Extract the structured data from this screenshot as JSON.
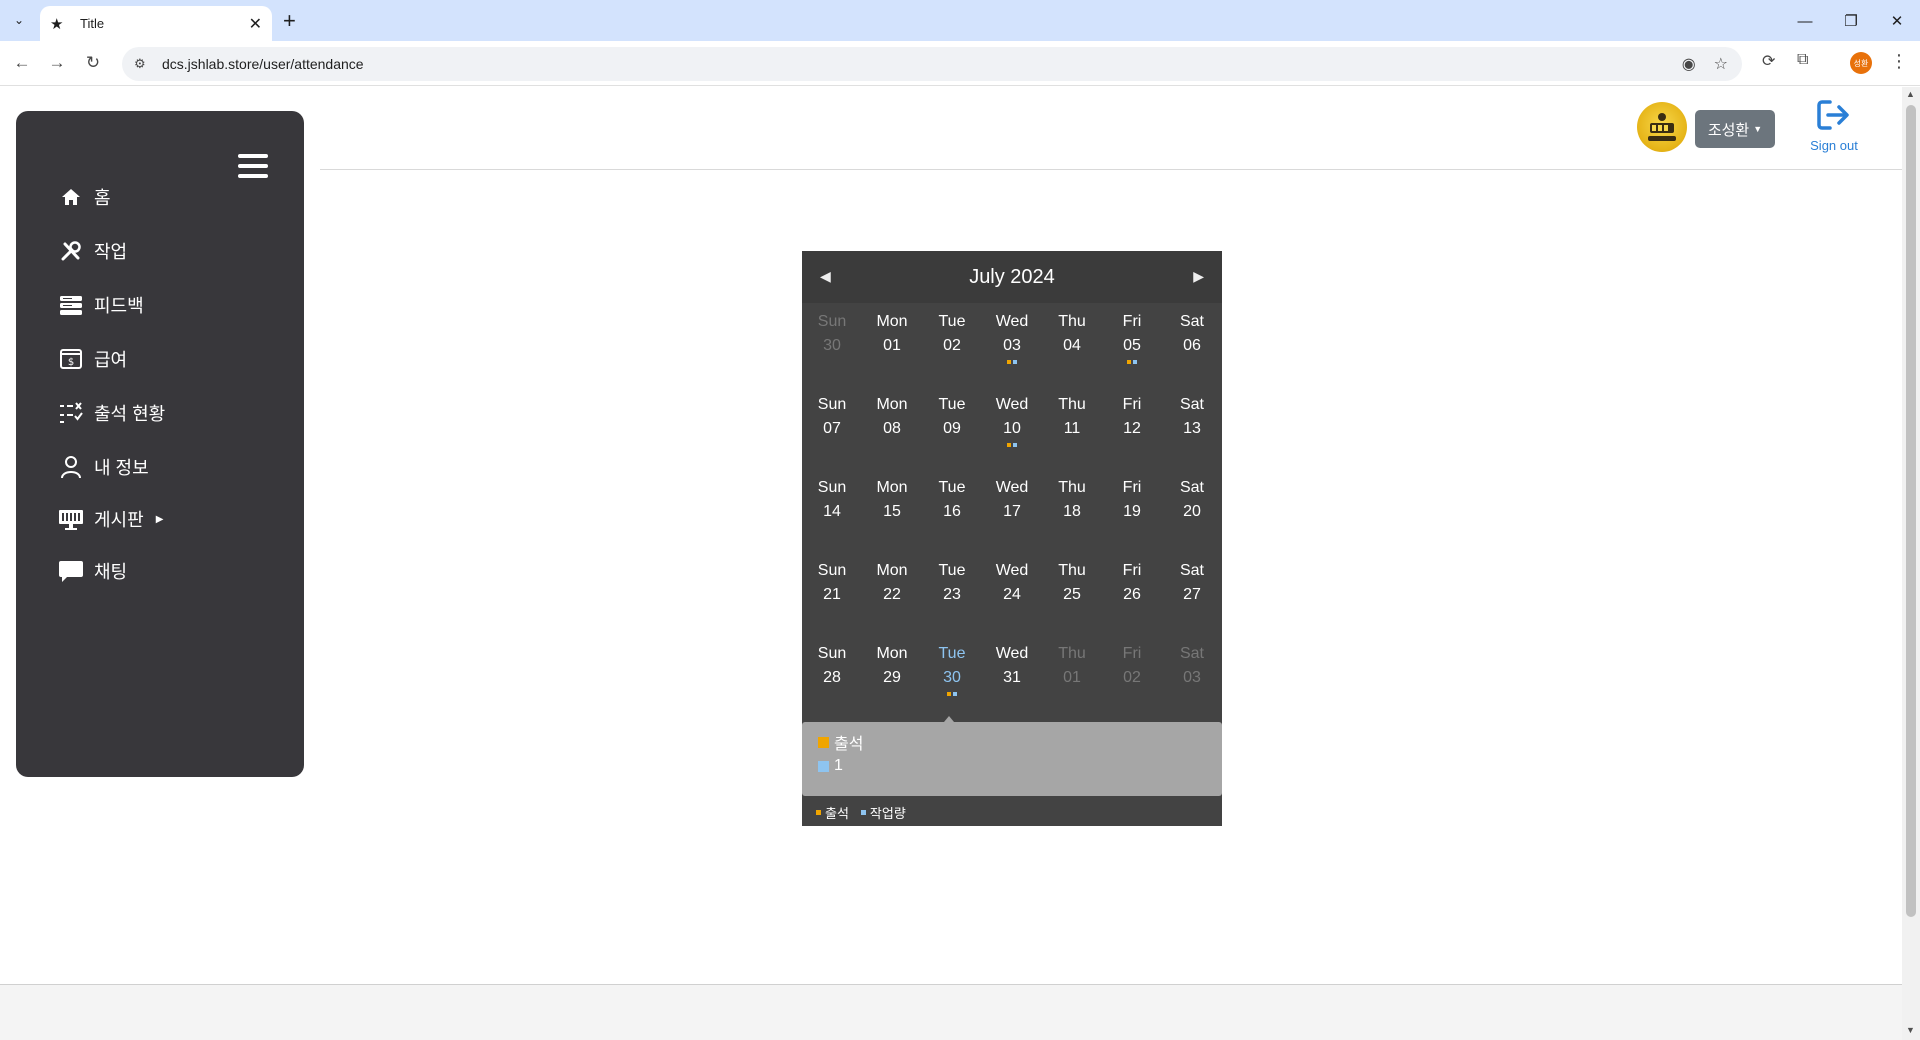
{
  "browser": {
    "tab_title": "Title",
    "url": "dcs.jshlab.store/user/attendance",
    "profile_initials": "성환"
  },
  "sidebar": {
    "items": [
      {
        "label": "홈",
        "icon": "home-icon"
      },
      {
        "label": "작업",
        "icon": "tools-icon"
      },
      {
        "label": "피드백",
        "icon": "feedback-icon"
      },
      {
        "label": "급여",
        "icon": "salary-icon"
      },
      {
        "label": "출석 현황",
        "icon": "checklist-icon"
      },
      {
        "label": "내 정보",
        "icon": "person-icon"
      },
      {
        "label": "게시판",
        "icon": "board-icon"
      },
      {
        "label": "채팅",
        "icon": "chat-icon"
      }
    ]
  },
  "header": {
    "user_name": "조성환",
    "signout_label": "Sign out"
  },
  "calendar": {
    "title": "July 2024",
    "colors": {
      "attendance": "#f0a500",
      "work": "#8ec4f0"
    },
    "weeks": [
      [
        {
          "dow": "Sun",
          "num": "30",
          "other": true
        },
        {
          "dow": "Mon",
          "num": "01"
        },
        {
          "dow": "Tue",
          "num": "02"
        },
        {
          "dow": "Wed",
          "num": "03",
          "dots": [
            "att",
            "work"
          ]
        },
        {
          "dow": "Thu",
          "num": "04"
        },
        {
          "dow": "Fri",
          "num": "05",
          "dots": [
            "att",
            "work"
          ]
        },
        {
          "dow": "Sat",
          "num": "06"
        }
      ],
      [
        {
          "dow": "Sun",
          "num": "07"
        },
        {
          "dow": "Mon",
          "num": "08"
        },
        {
          "dow": "Tue",
          "num": "09"
        },
        {
          "dow": "Wed",
          "num": "10",
          "dots": [
            "att",
            "work"
          ]
        },
        {
          "dow": "Thu",
          "num": "11"
        },
        {
          "dow": "Fri",
          "num": "12"
        },
        {
          "dow": "Sat",
          "num": "13"
        }
      ],
      [
        {
          "dow": "Sun",
          "num": "14"
        },
        {
          "dow": "Mon",
          "num": "15"
        },
        {
          "dow": "Tue",
          "num": "16"
        },
        {
          "dow": "Wed",
          "num": "17"
        },
        {
          "dow": "Thu",
          "num": "18"
        },
        {
          "dow": "Fri",
          "num": "19"
        },
        {
          "dow": "Sat",
          "num": "20"
        }
      ],
      [
        {
          "dow": "Sun",
          "num": "21"
        },
        {
          "dow": "Mon",
          "num": "22"
        },
        {
          "dow": "Tue",
          "num": "23"
        },
        {
          "dow": "Wed",
          "num": "24"
        },
        {
          "dow": "Thu",
          "num": "25"
        },
        {
          "dow": "Fri",
          "num": "26"
        },
        {
          "dow": "Sat",
          "num": "27"
        }
      ],
      [
        {
          "dow": "Sun",
          "num": "28"
        },
        {
          "dow": "Mon",
          "num": "29"
        },
        {
          "dow": "Tue",
          "num": "30",
          "today": true,
          "dots": [
            "att",
            "work"
          ]
        },
        {
          "dow": "Wed",
          "num": "31"
        },
        {
          "dow": "Thu",
          "num": "01",
          "other": true
        },
        {
          "dow": "Fri",
          "num": "02",
          "other": true
        },
        {
          "dow": "Sat",
          "num": "03",
          "other": true
        }
      ]
    ],
    "detail": [
      {
        "kind": "att",
        "text": "출석"
      },
      {
        "kind": "work",
        "text": "1"
      }
    ],
    "legend": [
      {
        "kind": "att",
        "text": "출석"
      },
      {
        "kind": "work",
        "text": "작업량"
      }
    ]
  }
}
